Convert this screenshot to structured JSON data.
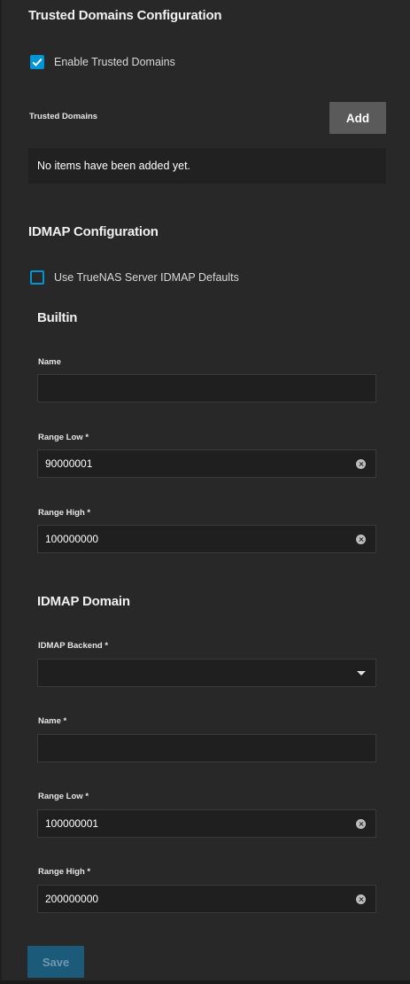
{
  "trusted_domains": {
    "heading": "Trusted Domains Configuration",
    "enable_label": "Enable Trusted Domains",
    "enable_checked": true,
    "list_label": "Trusted Domains",
    "add_label": "Add",
    "empty_text": "No items have been added yet."
  },
  "idmap": {
    "heading": "IDMAP Configuration",
    "use_defaults_label": "Use TrueNAS Server IDMAP Defaults",
    "use_defaults_checked": false,
    "builtin": {
      "heading": "Builtin",
      "name_label": "Name",
      "name_value": "",
      "range_low_label": "Range Low",
      "range_low_value": "90000001",
      "range_high_label": "Range High",
      "range_high_value": "100000000"
    },
    "domain": {
      "heading": "IDMAP Domain",
      "backend_label": "IDMAP Backend",
      "backend_value": "",
      "name_label": "Name",
      "name_value": "",
      "range_low_label": "Range Low",
      "range_low_value": "100000001",
      "range_high_label": "Range High",
      "range_high_value": "200000000"
    },
    "required_marker": "*"
  },
  "footer": {
    "save_label": "Save",
    "save_enabled": false
  },
  "colors": {
    "background": "#282828",
    "accent": "#0095d5",
    "field_background": "#1f1f1f",
    "add_button": "#5a5a5a",
    "save_button_disabled": "#1c5a7a"
  },
  "icons": {
    "checkbox_checked": "check-icon",
    "input_clear": "clear-circle-icon",
    "select_open": "caret-down-icon"
  }
}
